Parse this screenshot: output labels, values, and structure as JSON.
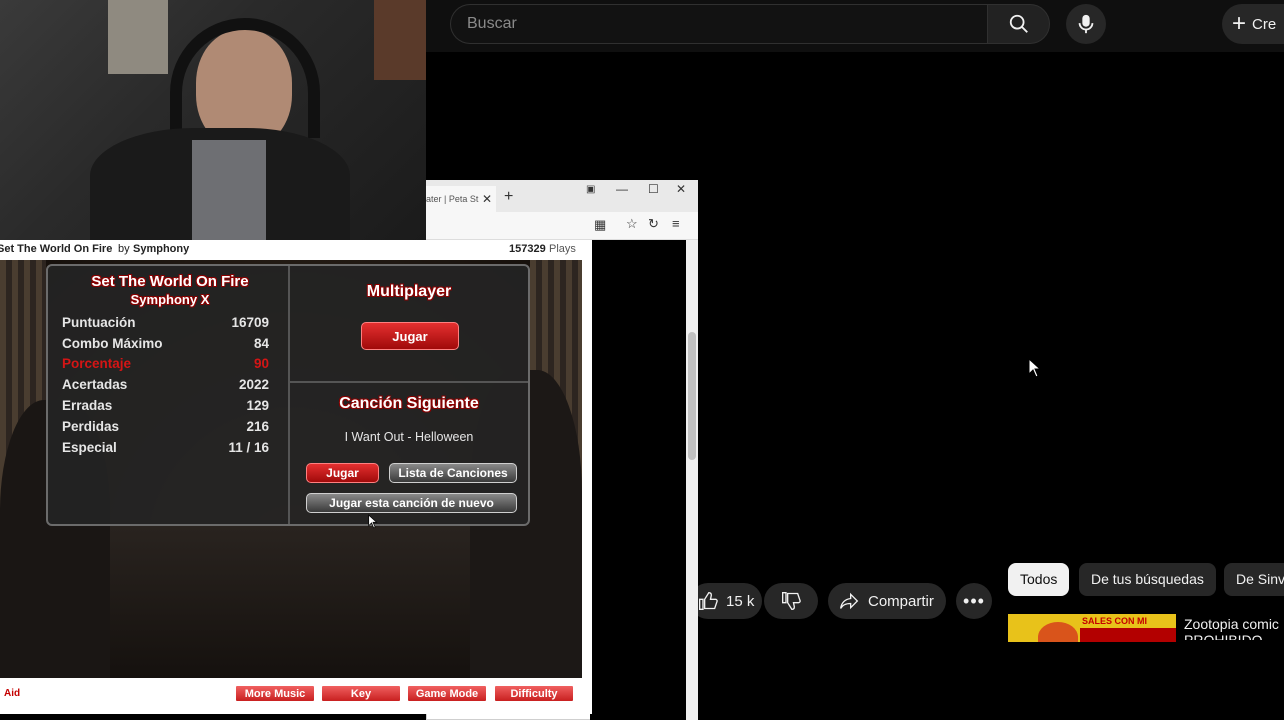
{
  "youtube": {
    "search_placeholder": "Buscar",
    "create_label": "Cre",
    "like_count": "15 k",
    "share_label": "Compartir",
    "chips": [
      "Todos",
      "De tus búsquedas",
      "De Sinv"
    ],
    "video_title": "Zootopia comic",
    "video_title_line2": "PROHIBIDO",
    "thumbnail_text": "SALES CON MI"
  },
  "browser": {
    "tab_title": "ater | Peta St"
  },
  "game": {
    "song_title": "Set The World On Fire",
    "by_text": "by",
    "artist": "Symphony",
    "plays_count": "157329",
    "plays_label": "Plays",
    "panel_title": "Set The World On Fire",
    "panel_artist": "Symphony X",
    "stats": [
      {
        "label": "Puntuación",
        "value": "16709",
        "highlight": false
      },
      {
        "label": "Combo Máximo",
        "value": "84",
        "highlight": false
      },
      {
        "label": "Porcentaje",
        "value": "90",
        "highlight": true
      },
      {
        "label": "Acertadas",
        "value": "2022",
        "highlight": false
      },
      {
        "label": "Erradas",
        "value": "129",
        "highlight": false
      },
      {
        "label": "Perdidas",
        "value": "216",
        "highlight": false
      },
      {
        "label": "Especial",
        "value": "11 / 16",
        "highlight": false
      }
    ],
    "multiplayer_title": "Multiplayer",
    "multiplayer_play": "Jugar",
    "next_song_title": "Canción Siguiente",
    "next_song": "I Want Out - Helloween",
    "play_label": "Jugar",
    "song_list_label": "Lista de Canciones",
    "replay_label": "Jugar esta canción de nuevo",
    "footer_left": "Aid",
    "footer_buttons": [
      "More Music",
      "Key",
      "Game Mode",
      "Difficulty"
    ]
  },
  "colors": {
    "accent_red": "#d41515",
    "yt_bg": "#0f0f0f",
    "chip_bg": "#272727"
  }
}
